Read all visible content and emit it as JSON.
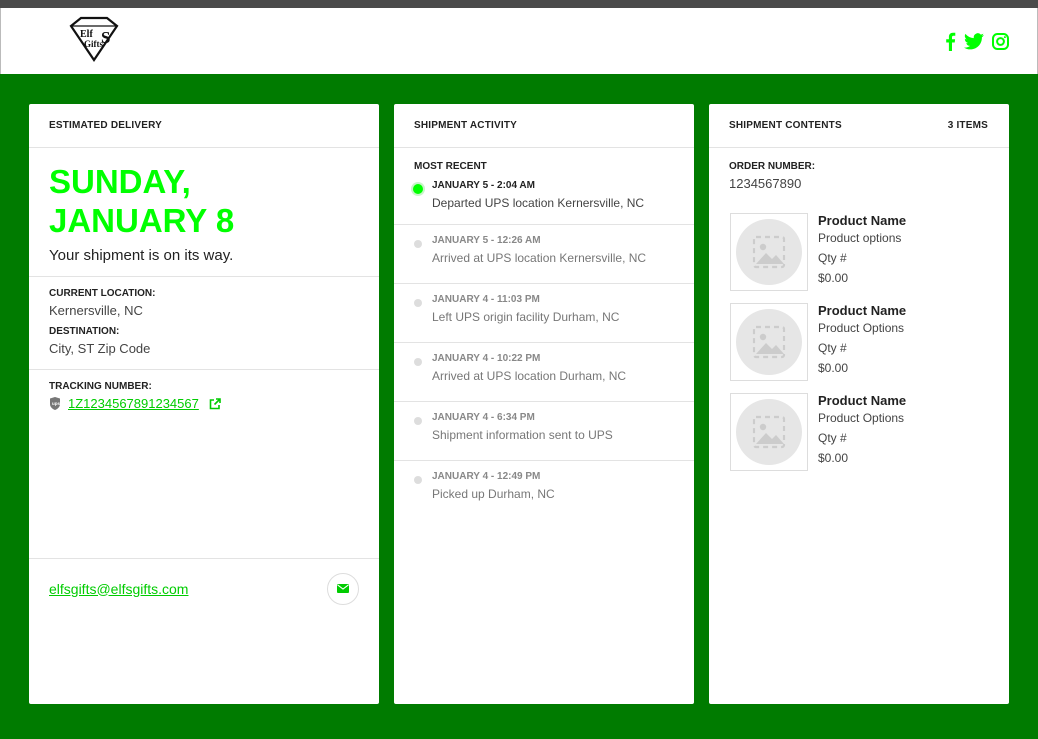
{
  "brand": {
    "logo_text_top": "Elf",
    "logo_text_bottom": "Gifts",
    "logo_letter": "S",
    "accent_color": "#00ff00",
    "background_color": "#007b00"
  },
  "social": {
    "icons": [
      "facebook-icon",
      "twitter-icon",
      "instagram-icon"
    ]
  },
  "delivery": {
    "header": "ESTIMATED DELIVERY",
    "date_line1": "SUNDAY,",
    "date_line2": "JANUARY 8",
    "message": "Your shipment is on its way.",
    "current_location_label": "CURRENT LOCATION:",
    "current_location": "Kernersville, NC",
    "destination_label": "DESTINATION:",
    "destination": "City, ST Zip Code",
    "tracking_label": "TRACKING NUMBER:",
    "tracking_number": "1Z1234567891234567",
    "email": "elfsgifts@elfsgifts.com"
  },
  "activity": {
    "header": "SHIPMENT ACTIVITY",
    "most_recent_label": "MOST RECENT",
    "items": [
      {
        "time": "JANUARY 5 - 2:04 AM",
        "desc": "Departed UPS location Kernersville, NC"
      },
      {
        "time": "JANUARY 5 - 12:26 AM",
        "desc": "Arrived at UPS location Kernersville, NC"
      },
      {
        "time": "JANUARY 4 - 11:03 PM",
        "desc": "Left UPS origin facility Durham, NC"
      },
      {
        "time": "JANUARY 4 - 10:22 PM",
        "desc": "Arrived at UPS location Durham, NC"
      },
      {
        "time": "JANUARY 4 - 6:34 PM",
        "desc": "Shipment information sent to UPS"
      },
      {
        "time": "JANUARY 4 - 12:49 PM",
        "desc": "Picked up Durham, NC"
      }
    ]
  },
  "contents": {
    "header": "SHIPMENT CONTENTS",
    "item_count": "3 ITEMS",
    "order_label": "ORDER NUMBER:",
    "order_number": "1234567890",
    "products": [
      {
        "name": "Product Name",
        "options": "Product options",
        "qty": "Qty #",
        "price": "$0.00"
      },
      {
        "name": "Product Name",
        "options": "Product Options",
        "qty": "Qty #",
        "price": "$0.00"
      },
      {
        "name": "Product Name",
        "options": "Product Options",
        "qty": "Qty #",
        "price": "$0.00"
      }
    ]
  }
}
